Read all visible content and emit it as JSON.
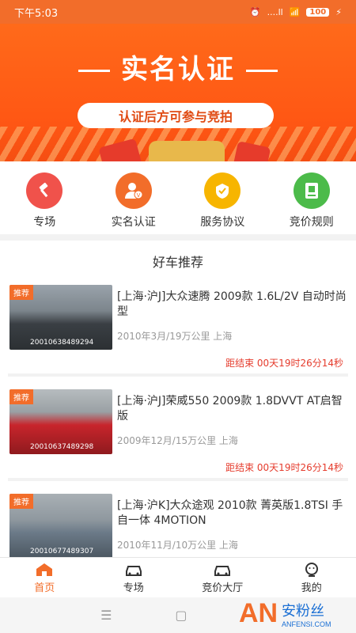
{
  "status": {
    "time": "下午5:03",
    "signal": "....ll",
    "battery": "100"
  },
  "banner": {
    "title": "实名认证",
    "subtitle": "认证后方可参与竞拍"
  },
  "quick_links": [
    {
      "label": "专场",
      "icon": "hammer-icon",
      "color": "#f0524b"
    },
    {
      "label": "实名认证",
      "icon": "verified-user-icon",
      "color": "#f26d2a"
    },
    {
      "label": "服务协议",
      "icon": "handshake-icon",
      "color": "#f7b500"
    },
    {
      "label": "竞价规则",
      "icon": "document-icon",
      "color": "#4cbb4a"
    }
  ],
  "section": {
    "title": "好车推荐"
  },
  "cars": [
    {
      "tag": "推荐",
      "id": "20010638489294",
      "title": "[上海·沪J]大众速腾 2009款 1.6L/2V 自动时尚型",
      "meta": "2010年3月/19万公里 上海",
      "countdown": "距结束 00天19时26分14秒",
      "car_color": "#3a3f44"
    },
    {
      "tag": "推荐",
      "id": "20010637489298",
      "title": "[上海·沪J]荣威550 2009款 1.8DVVT AT启智版",
      "meta": "2009年12月/15万公里 上海",
      "countdown": "距结束 00天19时26分14秒",
      "car_color": "#c8252c"
    },
    {
      "tag": "推荐",
      "id": "20010677489307",
      "title": "[上海·沪K]大众途观 2010款 菁英版1.8TSI 手自一体 4MOTION",
      "meta": "2010年11月/10万公里 上海",
      "countdown": "",
      "car_color": "#6b7a88"
    }
  ],
  "tabs": [
    {
      "label": "首页",
      "icon": "home-icon"
    },
    {
      "label": "专场",
      "icon": "car-icon"
    },
    {
      "label": "竞价大厅",
      "icon": "car-icon"
    },
    {
      "label": "我的",
      "icon": "user-icon"
    }
  ],
  "watermark": {
    "text": "安粉丝",
    "sub": "ANFENSI.COM"
  },
  "colors": {
    "accent": "#f26d2a",
    "countdown": "#e53b2c"
  }
}
